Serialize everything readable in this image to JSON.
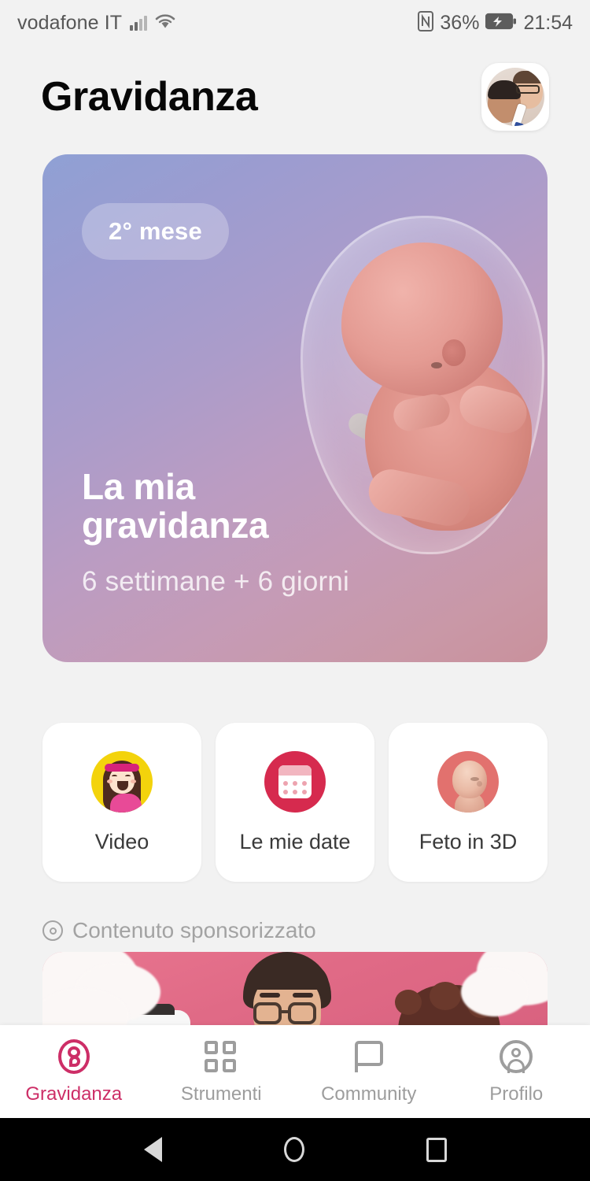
{
  "status_bar": {
    "carrier": "vodafone IT",
    "signal_icon": "signal-bars-icon",
    "wifi_icon": "wifi-icon",
    "nfc_icon": "nfc-icon",
    "battery_percent": "36%",
    "battery_icon": "battery-charging-icon",
    "clock": "21:54"
  },
  "header": {
    "title": "Gravidanza",
    "avatar_name": "user-avatar"
  },
  "hero": {
    "badge": "2° mese",
    "title_line1": "La mia",
    "title_line2": "gravidanza",
    "subtitle": "6 settimane + 6 giorni",
    "illustration": "fetus-in-amniotic-sac-illustration",
    "gradient_from": "#8fa0d4",
    "gradient_to": "#c9919c"
  },
  "quick_actions": [
    {
      "label": "Video",
      "icon": "video-girl-icon",
      "icon_color": "#f3d30c"
    },
    {
      "label": "Le mie date",
      "icon": "calendar-icon",
      "icon_color": "#d62a4e"
    },
    {
      "label": "Feto in 3D",
      "icon": "fetus-3d-icon",
      "icon_color": "#e2716e"
    }
  ],
  "sponsored": {
    "label": "Contenuto sponsorizzato",
    "icon": "target-icon",
    "banner": "sponsored-banner-image"
  },
  "bottom_nav": {
    "active_color": "#cd2e67",
    "inactive_color": "#9d9d9d",
    "items": [
      {
        "label": "Gravidanza",
        "icon": "pregnancy-icon"
      },
      {
        "label": "Strumenti",
        "icon": "grid-squares-icon"
      },
      {
        "label": "Community",
        "icon": "speech-bubble-icon"
      },
      {
        "label": "Profilo",
        "icon": "person-circle-icon"
      }
    ]
  },
  "android_nav": {
    "back": "back-triangle-icon",
    "home": "home-circle-icon",
    "recents": "recents-square-icon"
  }
}
